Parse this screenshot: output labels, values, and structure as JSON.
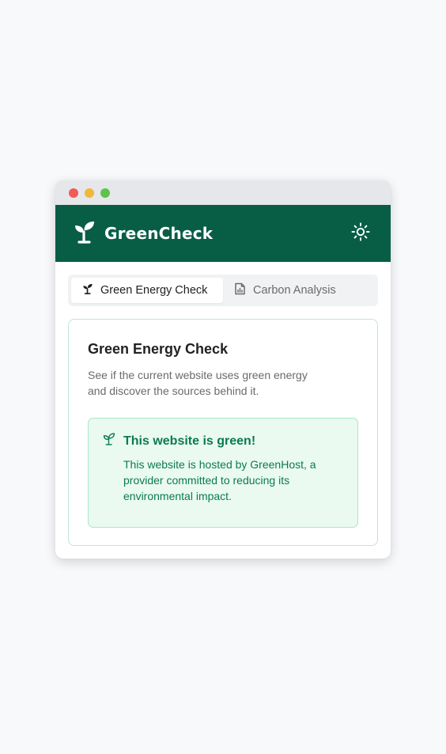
{
  "header": {
    "title": "GreenCheck",
    "logo_icon": "sprout-icon",
    "theme_toggle_icon": "sun-icon"
  },
  "tabs": [
    {
      "label": "Green Energy Check",
      "icon": "sprout-icon",
      "active": true
    },
    {
      "label": "Carbon Analysis",
      "icon": "chart-file-icon",
      "active": false
    }
  ],
  "card": {
    "title": "Green Energy Check",
    "description": "See if the current website uses green energy and discover the sources behind it."
  },
  "result": {
    "icon": "sprout-icon",
    "title": "This website is green!",
    "body": "This website is hosted by GreenHost, a provider committed to reducing its environmental impact."
  },
  "colors": {
    "brand": "#075e45",
    "success_text": "#0b7a51",
    "success_bg": "#eafaf1",
    "success_border": "#a8e6c6"
  }
}
